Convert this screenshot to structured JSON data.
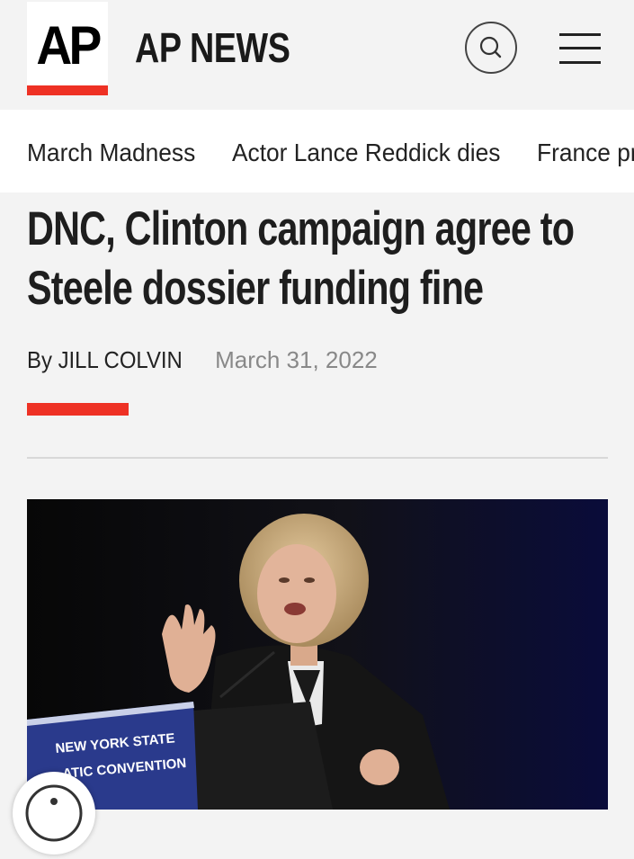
{
  "header": {
    "logo_text": "AP",
    "site_name": "AP NEWS",
    "accent_color": "#ee3124"
  },
  "nav": {
    "items": [
      "March Madness",
      "Actor Lance Reddick dies",
      "France pr"
    ]
  },
  "article": {
    "headline_line1": "DNC, Clinton campaign agree to",
    "headline_line2": "Steele dossier funding fine",
    "byline_prefix": "By",
    "author": "JILL COLVIN",
    "date": "March 31, 2022"
  },
  "photo": {
    "podium_line1": "NEW YORK STATE",
    "podium_line2": "ATIC CONVENTION"
  },
  "icons": [
    "search-icon",
    "hamburger-menu-icon",
    "accessibility-icon"
  ]
}
